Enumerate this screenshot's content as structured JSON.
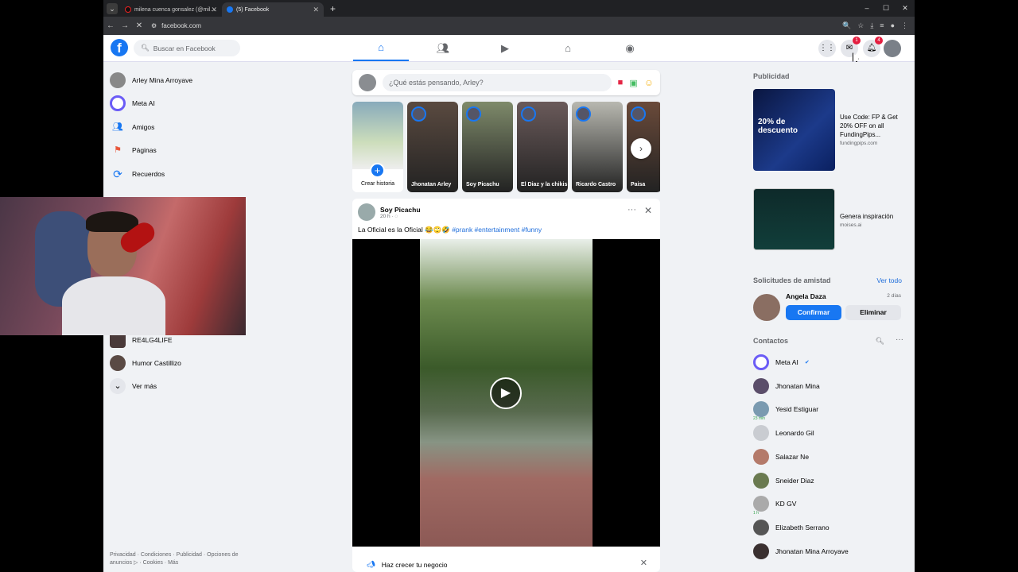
{
  "browser": {
    "tabs": [
      {
        "label": "milena cuenca gonsalez (@mil...",
        "active": false
      },
      {
        "label": "(5) Facebook",
        "active": true
      }
    ],
    "url": "facebook.com"
  },
  "fb": {
    "search_placeholder": "Buscar en Facebook",
    "messenger_badge": "1",
    "notif_badge": "4"
  },
  "left": {
    "items": [
      {
        "label": "Arley Mina Arroyave",
        "icon": "profile-avatar"
      },
      {
        "label": "Meta AI",
        "icon": "meta-ai-icon"
      },
      {
        "label": "Amigos",
        "icon": "friends-icon"
      },
      {
        "label": "Páginas",
        "icon": "pages-flag-icon"
      },
      {
        "label": "Recuerdos",
        "icon": "memories-clock-icon"
      },
      {
        "label": "RE4LG4LIFE",
        "icon": "group-avatar"
      },
      {
        "label": "Humor Castillizo",
        "icon": "group-avatar"
      },
      {
        "label": "Ver más",
        "icon": "chevron-down-icon"
      }
    ],
    "footer": "Privacidad · Condiciones · Publicidad · Opciones de anuncios ▷ · Cookies · Más"
  },
  "composer": {
    "placeholder": "¿Qué estás pensando, Arley?"
  },
  "stories": {
    "create_label": "Crear historia",
    "items": [
      {
        "name": "Jhonatan Arley",
        "color": "#5a4a40"
      },
      {
        "name": "Soy Picachu",
        "color": "#7e8a6a"
      },
      {
        "name": "El Diaz y la chikis",
        "color": "#6a5a5a"
      },
      {
        "name": "Ricardo Castro",
        "color": "#b8b8b0"
      },
      {
        "name": "Paisa",
        "color": "#6a4a3a"
      }
    ]
  },
  "post": {
    "author": "Soy Picachu",
    "time": "20 h · ",
    "text": "La Oficial es la Oficial 😂🙄🤣 ",
    "tags": "#prank #entertainment #funny",
    "promo": "Haz crecer tu negocio"
  },
  "right": {
    "ads_title": "Publicidad",
    "ads": [
      {
        "title": "Use Code: FP & Get 20% OFF on all FundingPips...",
        "domain": "fundingpips.com",
        "img_text": "20% de descuento"
      },
      {
        "title": "Genera inspiración",
        "domain": "moises.ai"
      }
    ],
    "friend_requests_title": "Solicitudes de amistad",
    "see_all": "Ver todo",
    "request": {
      "name": "Angela Daza",
      "time": "2 días",
      "confirm": "Confirmar",
      "delete": "Eliminar"
    },
    "contacts_title": "Contactos",
    "contacts": [
      {
        "name": "Meta AI",
        "sub": ""
      },
      {
        "name": "Jhonatan Mina",
        "sub": ""
      },
      {
        "name": "Yesid Estiguar",
        "sub": "23 min"
      },
      {
        "name": "Leonardo Gil",
        "sub": ""
      },
      {
        "name": "Salazar Ne",
        "sub": ""
      },
      {
        "name": "Sneider Diaz",
        "sub": ""
      },
      {
        "name": "KD GV",
        "sub": "1 h"
      },
      {
        "name": "Elizabeth Serrano",
        "sub": ""
      },
      {
        "name": "Jhonatan Mina Arroyave",
        "sub": ""
      }
    ]
  },
  "colors": {
    "brand": "#1877f2",
    "bg": "#f0f2f5",
    "badge": "#e41e3f"
  }
}
